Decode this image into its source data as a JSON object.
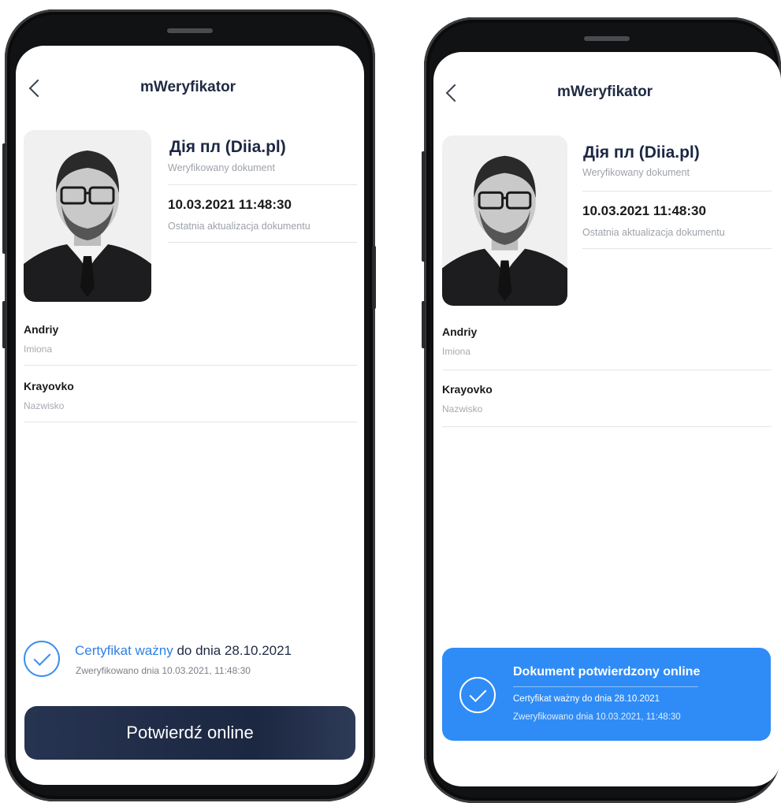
{
  "left_phone": {
    "header": {
      "title": "mWeryfikator"
    },
    "document": {
      "name": "Дія пл (Diia.pl)",
      "status": "Weryfikowany dokument",
      "datetime": "10.03.2021 11:48:30",
      "datetime_label": "Ostatnia aktualizacja dokumentu"
    },
    "fields": [
      {
        "value": "Andriy",
        "label": "Imiona"
      },
      {
        "value": "Krayovko",
        "label": "Nazwisko"
      }
    ],
    "certificate": {
      "valid_text": "Certyfikat ważny",
      "until_text": "do dnia 28.10.2021",
      "verified_text": "Zweryfikowano dnia 10.03.2021, 11:48:30"
    },
    "confirm_button": "Potwierdź online"
  },
  "right_phone": {
    "header": {
      "title": "mWeryfikator"
    },
    "document": {
      "name": "Дія пл (Diia.pl)",
      "status": "Weryfikowany dokument",
      "datetime": "10.03.2021 11:48:30",
      "datetime_label": "Ostatnia aktualizacja dokumentu"
    },
    "fields": [
      {
        "value": "Andriy",
        "label": "Imiona"
      },
      {
        "value": "Krayovko",
        "label": "Nazwisko"
      }
    ],
    "confirmation_card": {
      "title": "Dokument potwierdzony online",
      "certificate": "Certyfikat ważny do dnia 28.10.2021",
      "verified_text": "Zweryfikowano dnia 10.03.2021, 11:48:30"
    }
  },
  "colors": {
    "accent_blue": "#2f8cf6",
    "dark_navy": "#1c2741",
    "link_blue": "#2f80e6"
  },
  "icons": [
    "back-chevron-icon",
    "check-circle-icon",
    "id-photo"
  ]
}
